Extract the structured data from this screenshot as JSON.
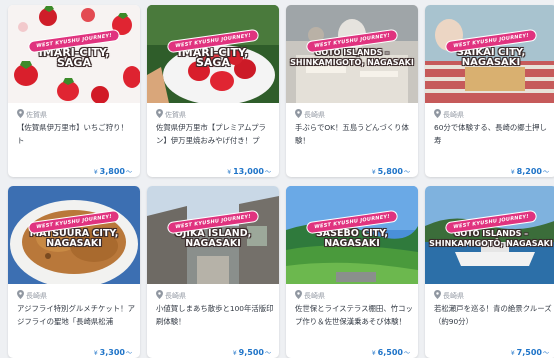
{
  "cards": [
    {
      "banner_text": "WEST KYUSHU JOURNEY!",
      "city_line1": "IMARI-CITY,",
      "city_line2": "SAGA",
      "prefecture": "佐賀県",
      "title": "【佐賀県伊万里市】いちご狩り！ト\nッピングアイス付き！90分！9種…",
      "currency": "¥",
      "price": "3,800",
      "price_suffix": "〜",
      "icon": "location-pin-icon",
      "photo": "strawberries-on-white"
    },
    {
      "banner_text": "WEST KYUSHU JOURNEY!",
      "city_line1": "IMARI-CITY,",
      "city_line2": "SAGA",
      "prefecture": "佐賀県",
      "title": "佐賀県伊万里市【プレミアムプラ\nン】伊万里焼おみやげ付き！プレ…",
      "currency": "¥",
      "price": "13,000",
      "price_suffix": "〜",
      "icon": "location-pin-icon",
      "photo": "strawberries-on-plate"
    },
    {
      "banner_text": "WEST KYUSHU JOURNEY!",
      "city_line1": "GOTŌ ISLANDS –",
      "city_line2": "SHINKAMIGOTŌ, NAGASAKI",
      "prefecture": "長崎県",
      "title": "手ぶらでOK！五島うどんづくり体\n験！",
      "currency": "¥",
      "price": "5,800",
      "price_suffix": "〜",
      "icon": "location-pin-icon",
      "photo": "udon-making"
    },
    {
      "banner_text": "WEST KYUSHU JOURNEY!",
      "city_line1": "SAIKAI CITY,",
      "city_line2": "NAGASAKI",
      "prefecture": "長崎県",
      "title": "60分で体験する、長崎の郷土押し寿\n司ワークショップ！",
      "currency": "¥",
      "price": "8,200",
      "price_suffix": "〜",
      "icon": "location-pin-icon",
      "photo": "sushi-workshop"
    },
    {
      "banner_text": "WEST KYUSHU JOURNEY!",
      "city_line1": "MATSUURA CITY,",
      "city_line2": "NAGASAKI",
      "prefecture": "長崎県",
      "title": "アジフライ特別グルメチケット！ア\nジフライの聖地「長崎県松浦市」…",
      "currency": "¥",
      "price": "3,300",
      "price_suffix": "〜",
      "icon": "location-pin-icon",
      "photo": "fried-fish"
    },
    {
      "banner_text": "WEST KYUSHU JOURNEY!",
      "city_line1": "OJIKA ISLAND,",
      "city_line2": "NAGASAKI",
      "prefecture": "長崎県",
      "title": "小値賀しまあち散歩と100年活版印\n刷体験！",
      "currency": "¥",
      "price": "9,500",
      "price_suffix": "〜",
      "icon": "location-pin-icon",
      "photo": "old-street"
    },
    {
      "banner_text": "WEST KYUSHU JOURNEY!",
      "city_line1": "SASEBO CITY,",
      "city_line2": "NAGASAKI",
      "prefecture": "長崎県",
      "title": "佐世保とライステラス棚田、竹コッ\nプ作り＆佐世保漢乗あそび体験！",
      "currency": "¥",
      "price": "6,500",
      "price_suffix": "〜",
      "icon": "location-pin-icon",
      "photo": "rice-terraces"
    },
    {
      "banner_text": "WEST KYUSHU JOURNEY!",
      "city_line1": "GOTŌ ISLANDS –",
      "city_line2": "SHINKAMIGOTŌ, NAGASAKI",
      "prefecture": "長崎県",
      "title": "若松瀬戸を巡る！青の絶景クルーズ\n（約90分）",
      "currency": "¥",
      "price": "7,500",
      "price_suffix": "〜",
      "icon": "location-pin-icon",
      "photo": "boat-cruise"
    }
  ],
  "colors": {
    "price": "#1f74c8",
    "banner_pink": "#e0337f",
    "prefecture_gray": "#9097a1",
    "page_background": "#eef0f3"
  }
}
